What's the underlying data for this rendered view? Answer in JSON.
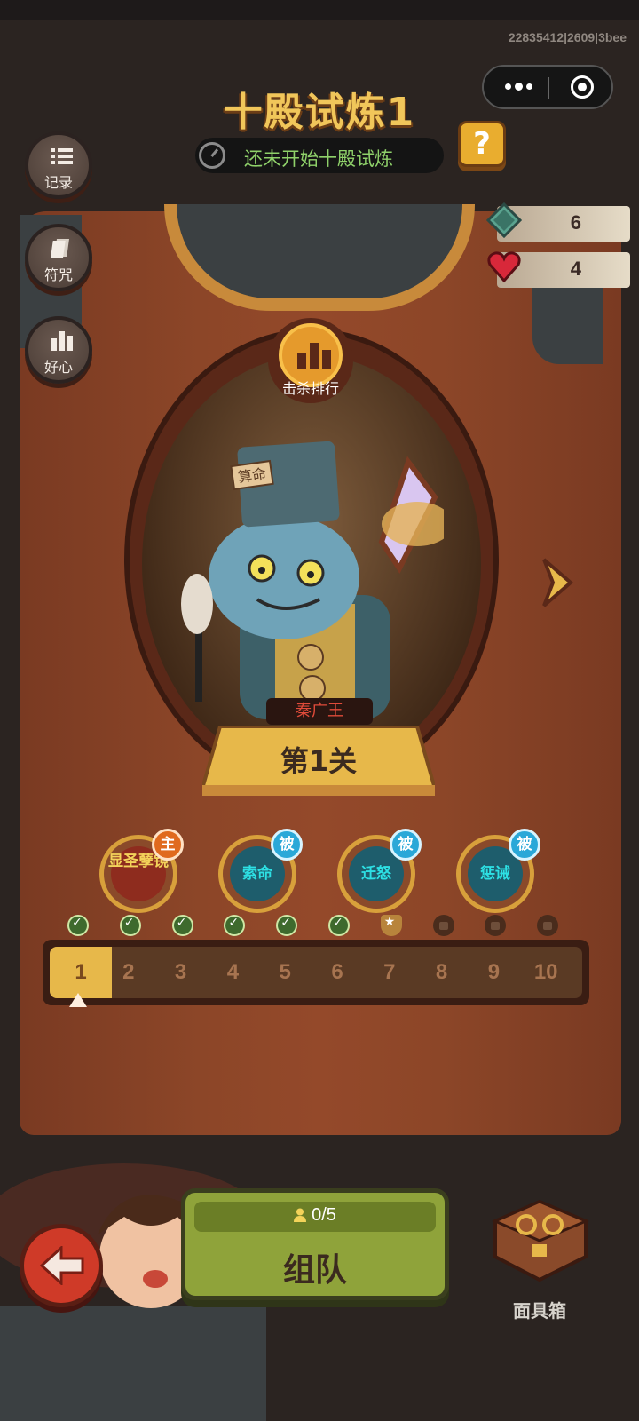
{
  "debug_text": "22835412|2609|3bee",
  "header": {
    "title": "十殿试炼1",
    "status": "还未开始十殿试炼",
    "help_label": "?"
  },
  "side_buttons": [
    {
      "label": "记录",
      "icon": "list-icon"
    },
    {
      "label": "符咒",
      "icon": "talisman-icon"
    },
    {
      "label": "好心",
      "icon": "bar-chart-icon"
    }
  ],
  "resources": [
    {
      "name": "jade",
      "value": "6",
      "icon": "jade-gem-icon",
      "color": "#5aa38f"
    },
    {
      "name": "heart",
      "value": "4",
      "icon": "heart-icon",
      "color": "#d8283a"
    }
  ],
  "rank_button": {
    "label": "击杀排行"
  },
  "boss": {
    "name": "秦广王",
    "hat_text": "算命"
  },
  "stage": {
    "label": "第1关"
  },
  "skills": [
    {
      "label": "显圣孽镜",
      "tag": "主",
      "type": "main"
    },
    {
      "label": "索命",
      "tag": "被",
      "type": "passive"
    },
    {
      "label": "迁怒",
      "tag": "被",
      "type": "passive"
    },
    {
      "label": "惩诫",
      "tag": "被",
      "type": "passive"
    }
  ],
  "progress": {
    "current": 1,
    "stages": [
      {
        "label": "1",
        "state": "cleared"
      },
      {
        "label": "2",
        "state": "cleared"
      },
      {
        "label": "3",
        "state": "cleared"
      },
      {
        "label": "4",
        "state": "cleared"
      },
      {
        "label": "5",
        "state": "cleared"
      },
      {
        "label": "6",
        "state": "cleared"
      },
      {
        "label": "7",
        "state": "reward"
      },
      {
        "label": "8",
        "state": "locked"
      },
      {
        "label": "9",
        "state": "locked"
      },
      {
        "label": "10",
        "state": "locked"
      }
    ]
  },
  "team": {
    "count": "0/5",
    "label": "组队"
  },
  "chest": {
    "label": "面具箱"
  },
  "colors": {
    "accent": "#e7b84a",
    "board": "#8c4628",
    "team": "#8fa33a",
    "back": "#cf3a28"
  }
}
